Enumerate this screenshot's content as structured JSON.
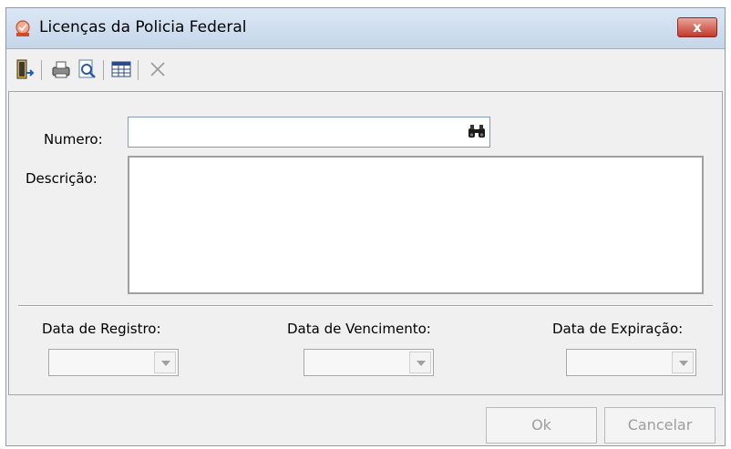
{
  "window": {
    "title": "Licenças da Policia Federal",
    "close_glyph": "x",
    "accent": "#c3392a"
  },
  "toolbar": {
    "items": [
      {
        "name": "exit-icon"
      },
      {
        "name": "print-icon"
      },
      {
        "name": "print-preview-icon"
      },
      {
        "name": "grid-view-icon"
      },
      {
        "name": "delete-icon"
      }
    ]
  },
  "form": {
    "numero_label": "Numero:",
    "numero_value": "",
    "descricao_label": "Descrição:",
    "descricao_value": "",
    "data_registro_label": "Data de Registro:",
    "data_vencimento_label": "Data de Vencimento:",
    "data_expiracao_label": "Data de Expiração:"
  },
  "buttons": {
    "ok_label": "Ok",
    "cancel_label": "Cancelar"
  }
}
